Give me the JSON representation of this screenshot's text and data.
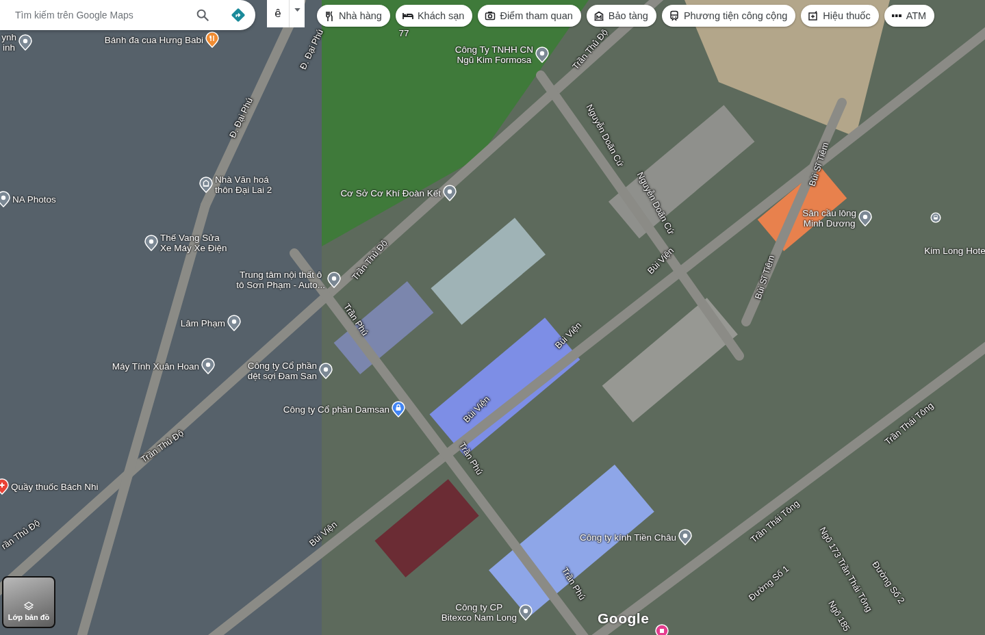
{
  "search": {
    "placeholder": "Tìm kiếm trên Google Maps"
  },
  "input_method": {
    "label": "ê"
  },
  "chips": [
    {
      "label": "Nhà hàng",
      "kind": "restaurant"
    },
    {
      "label": "Khách sạn",
      "kind": "hotel"
    },
    {
      "label": "Điểm tham quan",
      "kind": "attraction"
    },
    {
      "label": "Bảo tàng",
      "kind": "museum"
    },
    {
      "label": "Phương tiện công cộng",
      "kind": "transit"
    },
    {
      "label": "Hiệu thuốc",
      "kind": "pharmacy"
    },
    {
      "label": "ATM",
      "kind": "atm"
    }
  ],
  "places": [
    {
      "lines": [
        "ynh",
        "inh"
      ],
      "kind": "pin"
    },
    {
      "lines": [
        "77"
      ],
      "kind": "label"
    },
    {
      "lines": [
        "Bánh đa cua Hưng Babi"
      ],
      "kind": "restaurant"
    },
    {
      "lines": [
        "Công Ty TNHH CN",
        "Ngũ Kim Formosa"
      ],
      "kind": "pin"
    },
    {
      "lines": [
        "Nhà Văn hoá",
        "thôn Đại Lai 2"
      ],
      "kind": "museum"
    },
    {
      "lines": [
        "NA Photos"
      ],
      "kind": "pin"
    },
    {
      "lines": [
        "Cơ Sở Cơ Khí Đoàn Kết"
      ],
      "kind": "pin"
    },
    {
      "lines": [
        "Sân cầu lông",
        "Minh Dương"
      ],
      "kind": "pin"
    },
    {
      "kind": "bus"
    },
    {
      "lines": [
        "Thế Vang Sửa",
        "Xe Máy Xe Điện"
      ],
      "kind": "pin"
    },
    {
      "lines": [
        "Kim Long Hote"
      ],
      "kind": "label"
    },
    {
      "lines": [
        "Trung tâm nội thất ô",
        "tô Sơn Phạm - Auto..."
      ],
      "kind": "pin"
    },
    {
      "lines": [
        "Lâm Phạm"
      ],
      "kind": "pin"
    },
    {
      "lines": [
        "Máy Tính Xuân Hoan"
      ],
      "kind": "pin"
    },
    {
      "lines": [
        "Công ty Cổ phần",
        "dệt sợi Đam San"
      ],
      "kind": "pin"
    },
    {
      "lines": [
        "Công ty Cổ phần Damsan"
      ],
      "kind": "shop"
    },
    {
      "lines": [
        "Quầy thuốc Bách Nhi"
      ],
      "kind": "pharmacy"
    },
    {
      "lines": [
        "Công ty kính Tiền Châu"
      ],
      "kind": "pin"
    },
    {
      "lines": [
        "Công ty CP",
        "Bitexco Nam Long"
      ],
      "kind": "pin"
    },
    {
      "kind": "pink"
    }
  ],
  "streets": [
    {
      "name": "Đ. Đại Phú"
    },
    {
      "name": "Trần Thủ Độ"
    },
    {
      "name": "Đ. Đại Phú"
    },
    {
      "name": "Nguyễn Doãn Cứ"
    },
    {
      "name": "Bùi Sĩ Tiêm"
    },
    {
      "name": "Nguyễn Doãn Cứ"
    },
    {
      "name": "Trần Thủ Độ"
    },
    {
      "name": "Bùi Viện"
    },
    {
      "name": "Bùi Sĩ Tiêm"
    },
    {
      "name": "Trần Phú"
    },
    {
      "name": "Bùi Viện"
    },
    {
      "name": "Bùi Viện"
    },
    {
      "name": "Trần Thái Tông"
    },
    {
      "name": "Trần Thủ Độ"
    },
    {
      "name": "Trần Phú"
    },
    {
      "name": "Trần Thái Tông"
    },
    {
      "name": "rần Thủ Độ"
    },
    {
      "name": "Bùi Viện"
    },
    {
      "name": "Ngõ 173 Trần Thái Tông"
    },
    {
      "name": "Đường Số 1"
    },
    {
      "name": "Đường Số 2"
    },
    {
      "name": "Trần Phú"
    },
    {
      "name": "Ngõ 185"
    }
  ],
  "layers_button": {
    "label": "Lớp bản đồ"
  },
  "logo": {
    "text": "Google"
  }
}
